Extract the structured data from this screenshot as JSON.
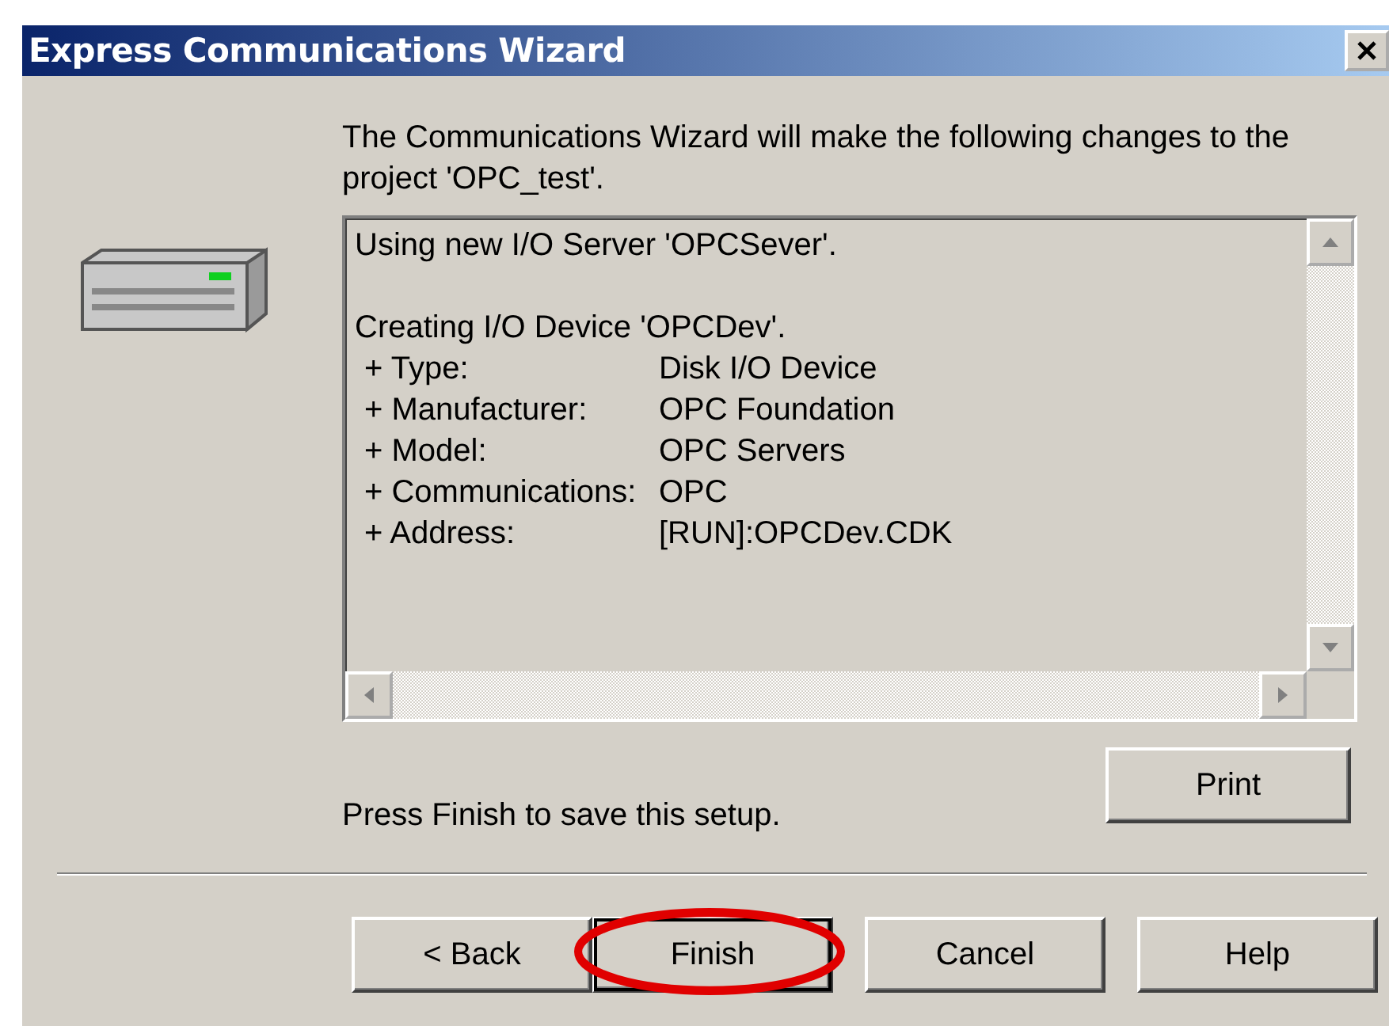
{
  "window": {
    "title": "Express Communications Wizard"
  },
  "intro": "The Communications Wizard will make the following changes to the project 'OPC_test'.",
  "changes": [
    {
      "heading": "Using new I/O Server 'OPCSever'."
    },
    {
      "heading": "Creating I/O Device 'OPCDev'.",
      "properties": [
        {
          "label": "+ Type:",
          "value": "Disk I/O Device"
        },
        {
          "label": "+ Manufacturer:",
          "value": "OPC Foundation"
        },
        {
          "label": "+ Model:",
          "value": "OPC Servers"
        },
        {
          "label": "+ Communications:",
          "value": "OPC"
        },
        {
          "label": "+ Address:",
          "value": "[RUN]:OPCDev.CDK"
        }
      ]
    }
  ],
  "note": "Press Finish to save this setup.",
  "print_button": "Print",
  "buttons": [
    {
      "label": "< Back",
      "default": false,
      "circled": false
    },
    {
      "label": "Finish",
      "default": true,
      "circled": true
    },
    {
      "label": "Cancel",
      "default": false,
      "circled": false
    },
    {
      "label": "Help",
      "default": false,
      "circled": false
    }
  ]
}
